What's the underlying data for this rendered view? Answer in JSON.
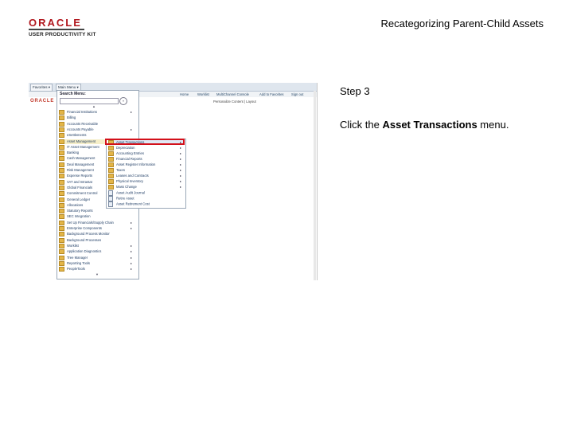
{
  "header": {
    "logo_oracle": "ORACLE",
    "logo_upk": "USER PRODUCTIVITY KIT",
    "doc_title": "Recategorizing Parent-Child Assets"
  },
  "step": {
    "label": "Step 3",
    "instruction_prefix": "Click the ",
    "instruction_target": "Asset Transactions",
    "instruction_suffix": " menu."
  },
  "screenshot": {
    "top_tabs": [
      "Favorites",
      "Main Menu"
    ],
    "top_links": [
      "Home",
      "Worklist",
      "MultiChannel Console",
      "Add to Favorites",
      "Sign out"
    ],
    "oracle_mark": "ORACLE",
    "personalize": "Personalize Content | Layout",
    "menu": {
      "search_label": "Search Menu:",
      "search_go": "»",
      "items": [
        {
          "label": "Financial Institutions",
          "arrow": true
        },
        {
          "label": "Billing",
          "arrow": false
        },
        {
          "label": "Accounts Receivable",
          "arrow": false
        },
        {
          "label": "Accounts Payable",
          "arrow": true
        },
        {
          "label": "eSettlements",
          "arrow": false
        },
        {
          "label": "Asset Management",
          "arrow": true
        },
        {
          "label": "IT Asset Management",
          "arrow": true
        },
        {
          "label": "Banking",
          "arrow": false
        },
        {
          "label": "Cash Management",
          "arrow": false
        },
        {
          "label": "Deal Management",
          "arrow": false
        },
        {
          "label": "Risk Management",
          "arrow": false
        },
        {
          "label": "Expense Reports",
          "arrow": false
        },
        {
          "label": "VAT and Intrastat",
          "arrow": false
        },
        {
          "label": "Global Financials",
          "arrow": false
        },
        {
          "label": "Commitment Control",
          "arrow": false
        },
        {
          "label": "General Ledger",
          "arrow": false
        },
        {
          "label": "Allocations",
          "arrow": false
        },
        {
          "label": "Statutory Reports",
          "arrow": false
        },
        {
          "label": "SEC Integration",
          "arrow": false
        },
        {
          "label": "Set Up Financials/Supply Chain",
          "arrow": true
        },
        {
          "label": "Enterprise Components",
          "arrow": true
        },
        {
          "label": "Background Process Monitor",
          "arrow": false
        },
        {
          "label": "Background Processes",
          "arrow": false
        },
        {
          "label": "Worklist",
          "arrow": true
        },
        {
          "label": "Application Diagnostics",
          "arrow": true
        },
        {
          "label": "Tree Manager",
          "arrow": true
        },
        {
          "label": "Reporting Tools",
          "arrow": true
        },
        {
          "label": "PeopleTools",
          "arrow": true
        }
      ]
    },
    "submenu": {
      "items": [
        {
          "label": "Asset Transactions",
          "arrow": true,
          "kind": "folder"
        },
        {
          "label": "Depreciation",
          "arrow": true,
          "kind": "folder"
        },
        {
          "label": "Accounting Entries",
          "arrow": true,
          "kind": "folder"
        },
        {
          "label": "Financial Reports",
          "arrow": true,
          "kind": "folder"
        },
        {
          "label": "Asset Register Information",
          "arrow": true,
          "kind": "folder"
        },
        {
          "label": "Taxes",
          "arrow": true,
          "kind": "folder"
        },
        {
          "label": "Leases and Contracts",
          "arrow": true,
          "kind": "folder"
        },
        {
          "label": "Physical Inventory",
          "arrow": true,
          "kind": "folder"
        },
        {
          "label": "Mass Change",
          "arrow": true,
          "kind": "folder"
        },
        {
          "label": "Asset Audit Journal",
          "arrow": false,
          "kind": "page"
        },
        {
          "label": "Retire Asset",
          "arrow": false,
          "kind": "page"
        },
        {
          "label": "Asset Retirement Cost",
          "arrow": false,
          "kind": "page"
        }
      ]
    }
  }
}
